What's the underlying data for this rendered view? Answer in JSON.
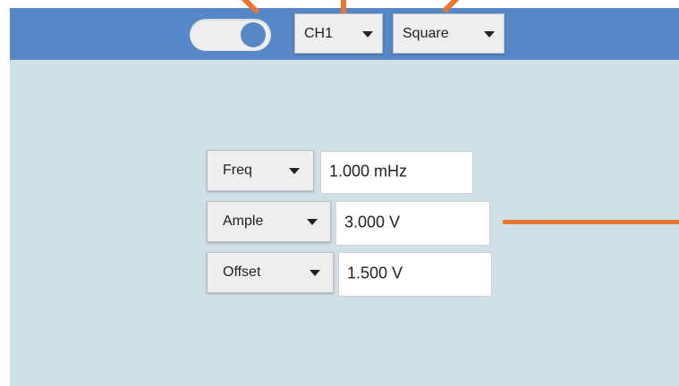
{
  "toolbar": {
    "toggle": {
      "state": "on"
    },
    "channel": {
      "selected": "CH1"
    },
    "waveform": {
      "selected": "Square"
    }
  },
  "params": [
    {
      "label": "Freq",
      "value": "1.000 mHz"
    },
    {
      "label": "Ample",
      "value": "3.000 V"
    },
    {
      "label": "Offset",
      "value": "1.500 V"
    }
  ],
  "colors": {
    "toolbar": "#5687c6",
    "panel": "#cfe0e7",
    "button": "#eeeeee",
    "annotation": "#e8782f"
  },
  "icons": {
    "dropdown": "triangle-down-icon"
  }
}
